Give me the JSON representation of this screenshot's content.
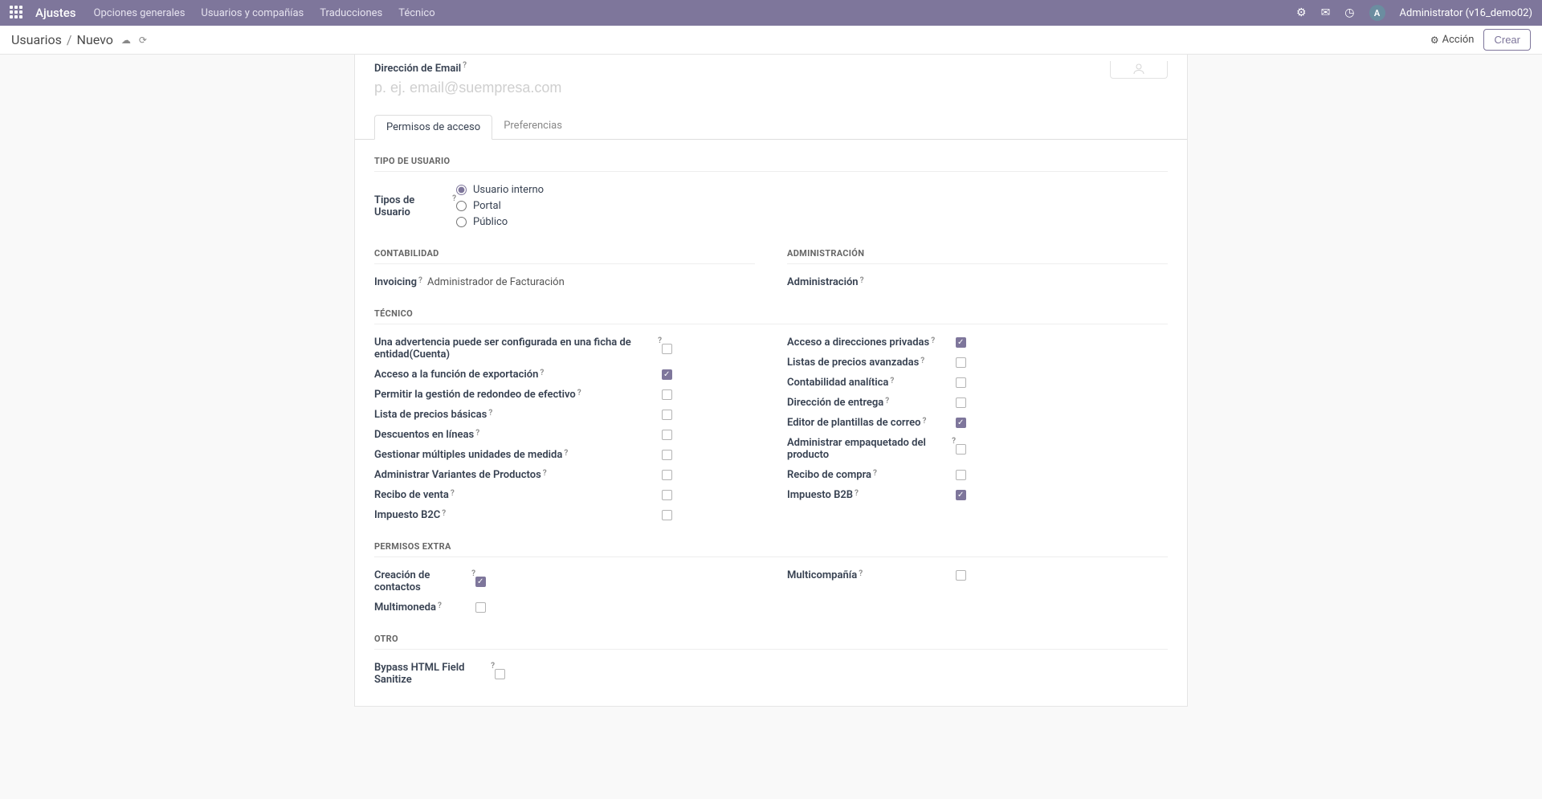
{
  "topnav": {
    "brand": "Ajustes",
    "links": [
      "Opciones generales",
      "Usuarios y compañías",
      "Traducciones",
      "Técnico"
    ],
    "user": "Administrator (v16_demo02)",
    "avatar_letter": "A"
  },
  "control_panel": {
    "breadcrumb_parent": "Usuarios",
    "breadcrumb_current": "Nuevo",
    "action": "Acción",
    "create": "Crear"
  },
  "email": {
    "label": "Dirección de Email",
    "placeholder": "p. ej. email@suempresa.com"
  },
  "tabs": {
    "access": "Permisos de acceso",
    "prefs": "Preferencias"
  },
  "sections": {
    "user_type": "TIPO DE USUARIO",
    "accounting": "CONTABILIDAD",
    "admin": "ADMINISTRACIÓN",
    "technical": "TÉCNICO",
    "extra": "PERMISOS EXTRA",
    "other": "OTRO"
  },
  "user_types_label": "Tipos de Usuario",
  "user_types": {
    "internal": "Usuario interno",
    "portal": "Portal",
    "public": "Público"
  },
  "accounting": {
    "invoicing_label": "Invoicing",
    "invoicing_value": "Administrador de Facturación"
  },
  "admin": {
    "label": "Administración"
  },
  "tech_left": [
    {
      "label": "Una advertencia puede ser configurada en una ficha de entidad(Cuenta)",
      "checked": false
    },
    {
      "label": "Acceso a la función de exportación",
      "checked": true
    },
    {
      "label": "Permitir la gestión de redondeo de efectivo",
      "checked": false
    },
    {
      "label": "Lista de precios básicas",
      "checked": false
    },
    {
      "label": "Descuentos en líneas",
      "checked": false
    },
    {
      "label": "Gestionar múltiples unidades de medida",
      "checked": false
    },
    {
      "label": "Administrar Variantes de Productos",
      "checked": false
    },
    {
      "label": "Recibo de venta",
      "checked": false
    },
    {
      "label": "Impuesto B2C",
      "checked": false
    }
  ],
  "tech_right": [
    {
      "label": "Acceso a direcciones privadas",
      "checked": true
    },
    {
      "label": "Listas de precios avanzadas",
      "checked": false
    },
    {
      "label": "Contabilidad analítica",
      "checked": false
    },
    {
      "label": "Dirección de entrega",
      "checked": false
    },
    {
      "label": "Editor de plantillas de correo",
      "checked": true
    },
    {
      "label": "Administrar empaquetado del producto",
      "checked": false
    },
    {
      "label": "Recibo de compra",
      "checked": false
    },
    {
      "label": "Impuesto B2B",
      "checked": true
    }
  ],
  "extra_left": [
    {
      "label": "Creación de contactos",
      "checked": true,
      "w": 126
    },
    {
      "label": "Multimoneda",
      "checked": false,
      "w": 126
    }
  ],
  "extra_right": [
    {
      "label": "Multicompañía",
      "checked": false
    }
  ],
  "other": [
    {
      "label": "Bypass HTML Field Sanitize",
      "checked": false
    }
  ]
}
